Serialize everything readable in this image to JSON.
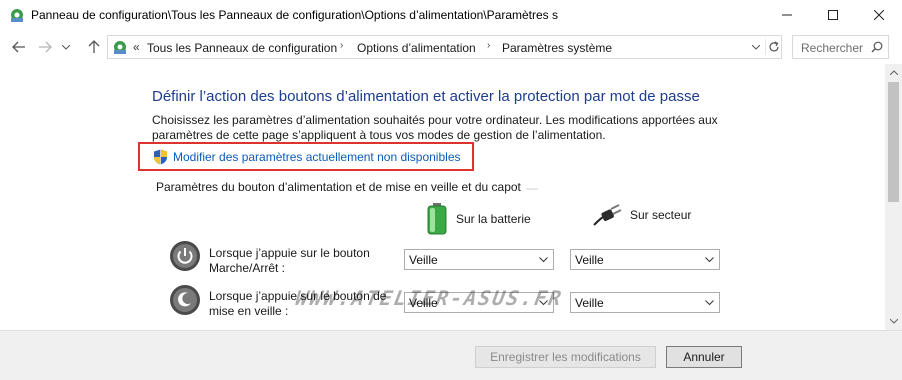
{
  "window": {
    "title": "Panneau de configuration\\Tous les Panneaux de configuration\\Options d’alimentation\\Paramètres s"
  },
  "address": {
    "more": "«",
    "crumbs": [
      "Tous les Panneaux de configuration",
      "Options d’alimentation",
      "Paramètres système"
    ],
    "search_placeholder": "Rechercher"
  },
  "main": {
    "heading": "Définir l’action des boutons d’alimentation et activer la protection par mot de passe",
    "description": "Choisissez les paramètres d’alimentation souhaités pour votre ordinateur. Les modifications apportées aux paramètres de cette page s’appliquent à tous vos modes de gestion de l’alimentation.",
    "change_link": "Modifier des paramètres actuellement non disponibles",
    "section_title": "Paramètres du bouton d’alimentation et de mise en veille et du capot",
    "columns": {
      "battery": "Sur la batterie",
      "ac": "Sur secteur"
    },
    "rows": [
      {
        "label": "Lorsque j’appuie sur le bouton Marche/Arrêt :",
        "battery": "Veille",
        "ac": "Veille"
      },
      {
        "label": "Lorsque j’appuie sur le bouton de mise en veille :",
        "battery": "Veille",
        "ac": "Veille"
      }
    ],
    "watermark": "WWW.ATELIER-ASUS.FR"
  },
  "footer": {
    "save": "Enregistrer les modifications",
    "cancel": "Annuler"
  },
  "colors": {
    "heading": "#1e3d8f",
    "link": "#0a5bbf",
    "highlight_box": "#e03131"
  }
}
